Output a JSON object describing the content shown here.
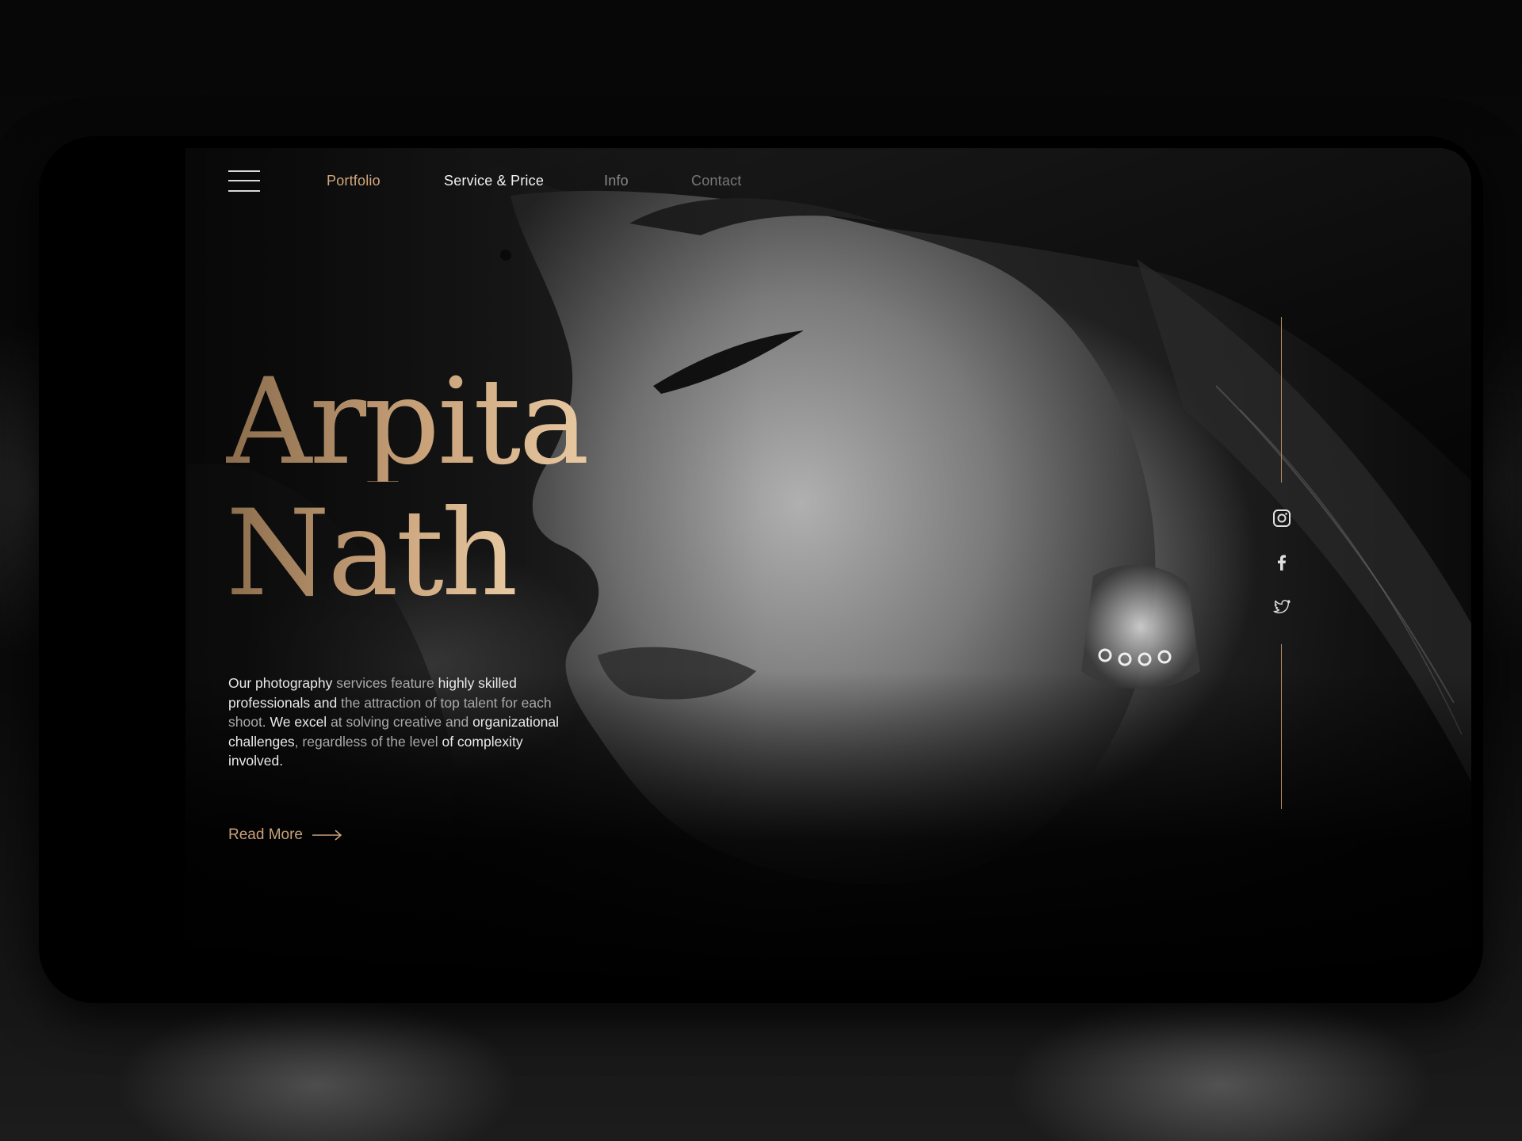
{
  "nav": {
    "items": [
      {
        "label": "Portfolio",
        "color": "#d2a77b"
      },
      {
        "label": "Service & Price",
        "color": "#f2f2f2"
      },
      {
        "label": "Info",
        "color": "#8a8a8a"
      },
      {
        "label": "Contact",
        "color": "#777777"
      }
    ]
  },
  "hero": {
    "first_name": "Arpita",
    "last_name": "Nath",
    "description": {
      "segments": [
        {
          "text": "Our photography ",
          "dim": false
        },
        {
          "text": "services feature ",
          "dim": true
        },
        {
          "text": "highly skilled professionals and ",
          "dim": false
        },
        {
          "text": "the attraction of top talent for each shoot. ",
          "dim": true
        },
        {
          "text": "We excel ",
          "dim": false
        },
        {
          "text": "at solving creative and ",
          "dim": true
        },
        {
          "text": "organizational challenges",
          "dim": false
        },
        {
          "text": ", regardless of the level ",
          "dim": true
        },
        {
          "text": "of complexity involved.",
          "dim": false
        }
      ]
    },
    "read_more_label": "Read More"
  },
  "social": {
    "icons": [
      "instagram-icon",
      "facebook-icon",
      "twitter-icon"
    ]
  },
  "colors": {
    "accent_gold": "#c9a27a",
    "line_gold": "#b38b63",
    "background": "#000000"
  }
}
